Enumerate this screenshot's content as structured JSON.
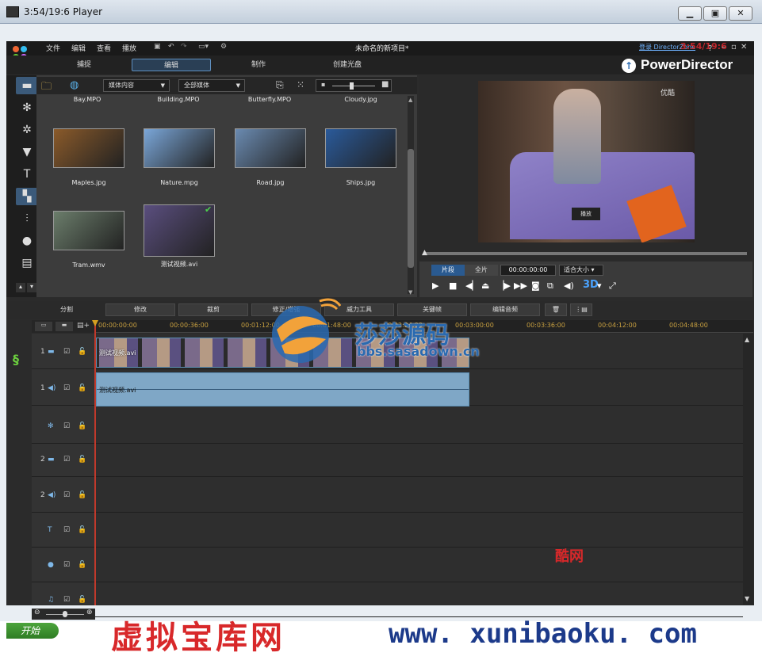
{
  "window": {
    "title": "3:54/19:6 Player",
    "min": "▁",
    "max": "▣",
    "close": "✕"
  },
  "menu": [
    "文件",
    "编辑",
    "查看",
    "播放"
  ],
  "project_title": "未命名的新项目*",
  "directorzone": "登录 DirectorZone",
  "red_time": "3:54/19:6",
  "main_tabs": [
    "捕捉",
    "编辑",
    "制作",
    "创建光盘"
  ],
  "brand": "PowerDirector",
  "library": {
    "filter1": "媒体内容",
    "filter2": "全部媒体",
    "top_labels": [
      "Bay.MPO",
      "Building.MPO",
      "Butterfly.MPO",
      "Cloudy.jpg"
    ],
    "items": [
      {
        "label": "Maples.jpg",
        "color": "#8a5a2a"
      },
      {
        "label": "Nature.mpg",
        "color": "#7aa6d8"
      },
      {
        "label": "Road.jpg",
        "color": "#6a8ab0"
      },
      {
        "label": "Ships.jpg",
        "color": "#2a5a9a"
      },
      {
        "label": "Tram.wmv",
        "color": "#6b7d6b"
      },
      {
        "label": "测试视频.avi",
        "color": "#5a4e7e"
      }
    ]
  },
  "preview": {
    "overlay_text": "播放",
    "watermark": "优酷",
    "mode_clip": "片段",
    "mode_full": "全片",
    "timecode": "00:00:00:00",
    "fit": "适合大小",
    "badge_3d": "3D"
  },
  "edit_buttons": [
    "分割",
    "修改",
    "裁剪",
    "修正/增强",
    "威力工具",
    "关键帧",
    "编辑音频"
  ],
  "ruler_ticks": [
    "00:00:00:00",
    "00:00:36:00",
    "00:01:12:00",
    "00:01:48:00",
    "00:02:24:00",
    "00:03:00:00",
    "00:03:36:00",
    "00:04:12:00",
    "00:04:48:00"
  ],
  "tracks": [
    {
      "num": "1",
      "type": "video"
    },
    {
      "num": "1",
      "type": "audio"
    },
    {
      "num": "",
      "type": "effect"
    },
    {
      "num": "2",
      "type": "video"
    },
    {
      "num": "2",
      "type": "audio"
    },
    {
      "num": "",
      "type": "title"
    },
    {
      "num": "",
      "type": "voice"
    },
    {
      "num": "",
      "type": "music"
    }
  ],
  "clip_label": "测试视频.avi",
  "audio_clip_label": "测试视频.avi",
  "taskbar": {
    "start": "开始"
  },
  "watermarks": {
    "bottom_cn": "虚拟宝库网",
    "bottom_url": "www. xunibaoku. com",
    "center_cn": "莎莎源码",
    "center_url": "bbs.sasadown.cn",
    "red_small": "酷网"
  }
}
